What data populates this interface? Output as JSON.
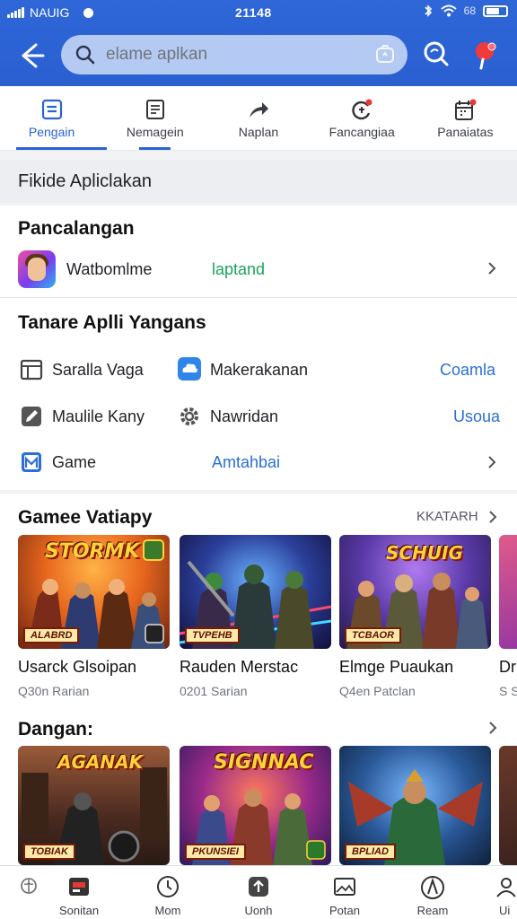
{
  "status_bar": {
    "carrier": "NAUIG",
    "time": "21148",
    "battery_text": "68"
  },
  "search": {
    "placeholder": "elame aplkan"
  },
  "tabs": [
    {
      "label": "Pengain",
      "icon": "list-icon",
      "active": true
    },
    {
      "label": "Nemagein",
      "icon": "document-icon",
      "active": false
    },
    {
      "label": "Naplan",
      "icon": "share-arrow-icon",
      "active": false
    },
    {
      "label": "Fancangiaa",
      "icon": "refresh-badge-icon",
      "active": false
    },
    {
      "label": "Panaiatas",
      "icon": "calendar-icon",
      "active": false
    }
  ],
  "section_header": "Fikide Apliclakan",
  "pancalangan": {
    "title": "Pancalangan",
    "app_name": "Watbomlme",
    "app_action": "laptand"
  },
  "tanare": {
    "title": "Tanare Aplli Yangans",
    "items": [
      {
        "label": "Saralla Vaga",
        "icon": "folder-icon"
      },
      {
        "label": "Makerakanan",
        "icon": "cloud-icon"
      },
      {
        "label": "Coamla",
        "icon": ""
      },
      {
        "label": "Maulile Kany",
        "icon": "edit-icon"
      },
      {
        "label": "Nawridan",
        "icon": "gear-icon"
      },
      {
        "label": "Usoua",
        "icon": ""
      },
      {
        "label": "Game",
        "icon": "mail-icon"
      },
      {
        "label": "Amtahbai",
        "icon": ""
      }
    ]
  },
  "game_section": {
    "title": "Gamee Vatiapy",
    "more_label": "KKATARH",
    "games": [
      {
        "name": "Usarck Glsoipan",
        "sub": "Q30n Rarian",
        "banner": "STORMK",
        "plate": "ALABRD"
      },
      {
        "name": "Rauden Merstac",
        "sub": "0201 Sarian",
        "banner": "",
        "plate": "TVPEHB"
      },
      {
        "name": "Elmge Puaukan",
        "sub": "Q4en Patclan",
        "banner": "SCHUIG",
        "plate": "TCBAOR"
      },
      {
        "name": "Dr",
        "sub": "S S",
        "banner": "",
        "plate": ""
      }
    ]
  },
  "dangan_section": {
    "title": "Dangan:",
    "games": [
      {
        "banner": "AGANAK",
        "plate": "TOBIAK"
      },
      {
        "banner": "SIGNNAC",
        "plate": "PKUNSIEI"
      },
      {
        "banner": "",
        "plate": "BPLIAD"
      },
      {
        "banner": "",
        "plate": ""
      }
    ]
  },
  "bottom_nav": [
    {
      "label": "Sonitan",
      "icon": "home-icon"
    },
    {
      "label": "Mom",
      "icon": "clock-icon"
    },
    {
      "label": "Uonh",
      "icon": "upload-icon"
    },
    {
      "label": "Potan",
      "icon": "image-icon"
    },
    {
      "label": "Ream",
      "icon": "compass-icon"
    },
    {
      "label": "Ui",
      "icon": "user-icon"
    }
  ],
  "colors": {
    "brand_blue": "#2a63d4",
    "green": "#1aa35a",
    "link_blue": "#2a6fd4"
  }
}
